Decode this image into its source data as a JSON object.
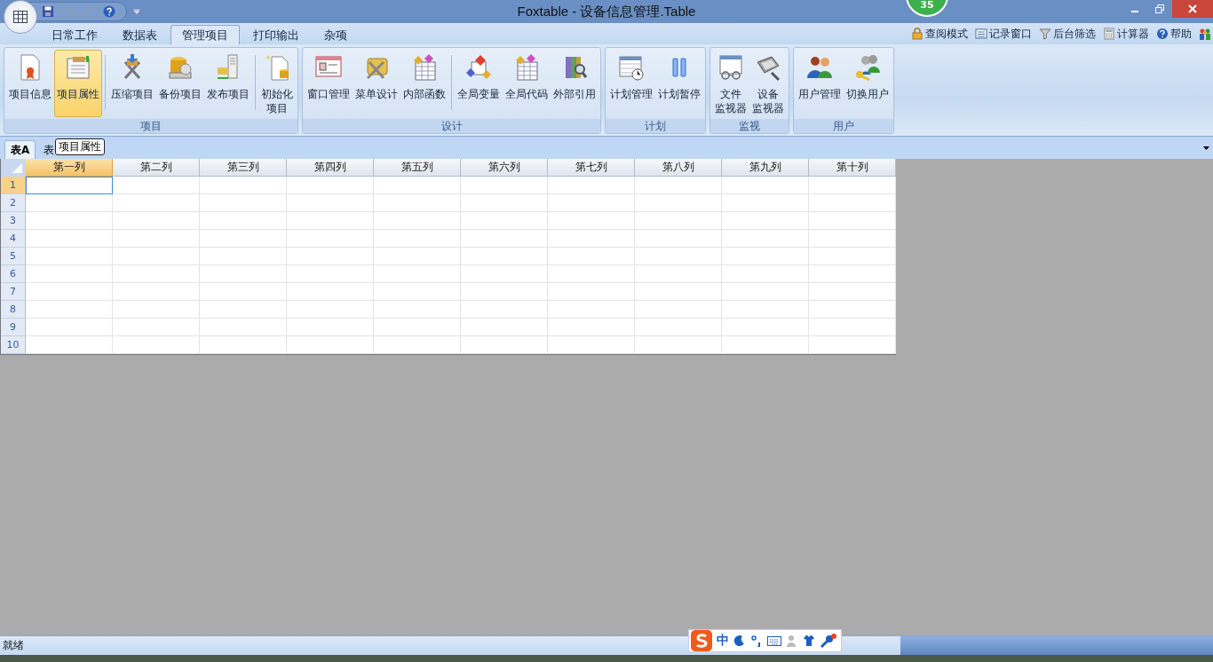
{
  "window": {
    "title": "Foxtable - 设备信息管理.Table",
    "badge": "35"
  },
  "menu_tabs": [
    {
      "label": "日常工作",
      "selected": false
    },
    {
      "label": "数据表",
      "selected": false
    },
    {
      "label": "管理项目",
      "selected": true
    },
    {
      "label": "打印输出",
      "selected": false
    },
    {
      "label": "杂项",
      "selected": false
    }
  ],
  "toolbar_right": [
    {
      "label": "查阅模式",
      "kind": "lock"
    },
    {
      "label": "记录窗口",
      "kind": "form"
    },
    {
      "label": "后台筛选",
      "kind": "filter"
    },
    {
      "label": "计算器",
      "kind": "calc"
    },
    {
      "label": "帮助",
      "kind": "help"
    },
    {
      "kind": "users"
    }
  ],
  "ribbon_groups": [
    {
      "label": "项目",
      "items": [
        {
          "label": "项目信息",
          "selected": false,
          "kind": "button"
        },
        {
          "label": "项目属性",
          "selected": true,
          "kind": "button"
        },
        {
          "kind": "separator"
        },
        {
          "label": "压缩项目",
          "selected": false,
          "kind": "button"
        },
        {
          "label": "备份项目",
          "selected": false,
          "kind": "button"
        },
        {
          "label": "发布项目",
          "selected": false,
          "kind": "button"
        },
        {
          "kind": "separator"
        },
        {
          "label_lines": [
            "初始化",
            "项目"
          ],
          "selected": false,
          "kind": "button"
        }
      ]
    },
    {
      "label": "设计",
      "items": [
        {
          "label": "窗口管理",
          "selected": false,
          "kind": "button"
        },
        {
          "label": "菜单设计",
          "selected": false,
          "kind": "button"
        },
        {
          "label": "内部函数",
          "selected": false,
          "kind": "button"
        },
        {
          "kind": "separator"
        },
        {
          "label": "全局变量",
          "selected": false,
          "kind": "button"
        },
        {
          "label": "全局代码",
          "selected": false,
          "kind": "button"
        },
        {
          "label": "外部引用",
          "selected": false,
          "kind": "button"
        }
      ]
    },
    {
      "label": "计划",
      "items": [
        {
          "label": "计划管理",
          "selected": false,
          "kind": "button"
        },
        {
          "label": "计划暂停",
          "selected": false,
          "kind": "button"
        }
      ]
    },
    {
      "label": "监视",
      "items": [
        {
          "label_lines": [
            "文件",
            "监视器"
          ],
          "selected": false,
          "kind": "button"
        },
        {
          "label_lines": [
            "设备",
            "监视器"
          ],
          "selected": false,
          "kind": "button"
        }
      ]
    },
    {
      "label": "用户",
      "items": [
        {
          "label": "用户管理",
          "selected": false,
          "kind": "button"
        },
        {
          "label": "切换用户",
          "selected": false,
          "kind": "button"
        }
      ]
    }
  ],
  "sheet_tabs": [
    {
      "label": "表A",
      "selected": true
    },
    {
      "label": "表",
      "selected": false
    }
  ],
  "tooltip": "项目属性",
  "grid": {
    "columns": [
      {
        "label": "第一列",
        "selected": true
      },
      {
        "label": "第二列",
        "selected": false
      },
      {
        "label": "第三列",
        "selected": false
      },
      {
        "label": "第四列",
        "selected": false
      },
      {
        "label": "第五列",
        "selected": false
      },
      {
        "label": "第六列",
        "selected": false
      },
      {
        "label": "第七列",
        "selected": false
      },
      {
        "label": "第八列",
        "selected": false
      },
      {
        "label": "第九列",
        "selected": false
      },
      {
        "label": "第十列",
        "selected": false
      }
    ],
    "rows": [
      {
        "number": "1",
        "selected": true
      },
      {
        "number": "2",
        "selected": false
      },
      {
        "number": "3",
        "selected": false
      },
      {
        "number": "4",
        "selected": false
      },
      {
        "number": "5",
        "selected": false
      },
      {
        "number": "6",
        "selected": false
      },
      {
        "number": "7",
        "selected": false
      },
      {
        "number": "8",
        "selected": false
      },
      {
        "number": "9",
        "selected": false
      },
      {
        "number": "10",
        "selected": false
      }
    ]
  },
  "status_bar": {
    "text": "就绪"
  },
  "ime_bar": {
    "mode": "中"
  }
}
